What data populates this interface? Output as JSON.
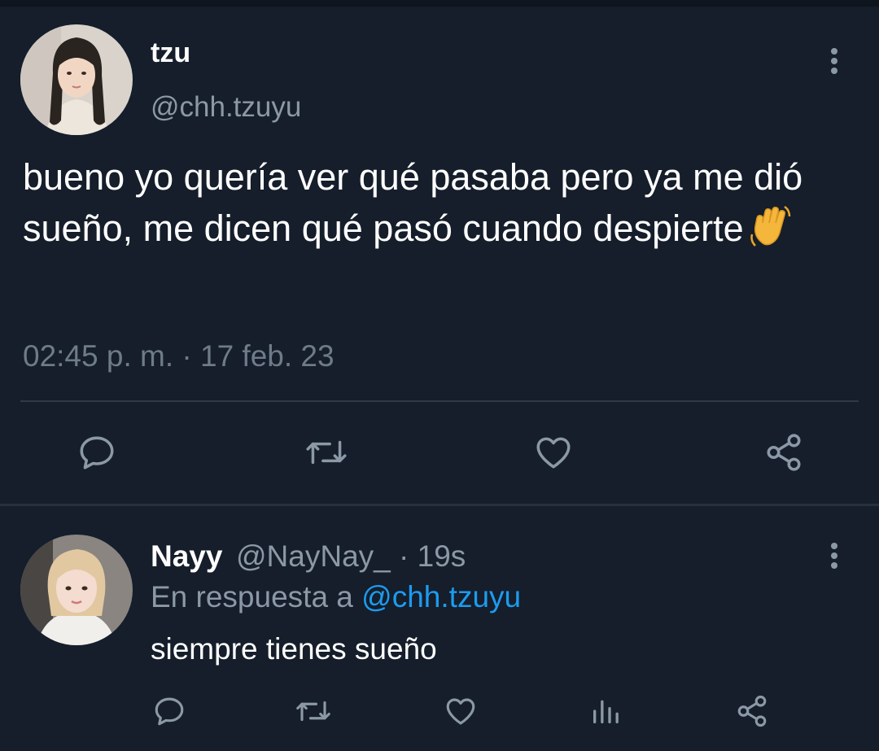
{
  "tweet": {
    "display_name": "tzu",
    "handle": "@chh.tzuyu",
    "text": "bueno yo quería ver qué pasaba pero ya me dió sueño, me dicen qué pasó cuando despierte",
    "emoji": "waving-hand",
    "timestamp": "02:45 p. m. · 17 feb. 23",
    "actions": [
      "reply-icon",
      "retweet-icon",
      "like-icon",
      "share-icon"
    ]
  },
  "reply": {
    "display_name": "Nayy",
    "meta": "@NayNay_ · 19s",
    "reply_prefix": "En respuesta a",
    "reply_mention": "@chh.tzuyu",
    "text": "siempre tienes sueño",
    "actions": [
      "reply-icon",
      "retweet-icon",
      "like-icon",
      "views-icon",
      "share-icon"
    ]
  },
  "colors": {
    "background": "#151e2a",
    "text": "#ffffff",
    "secondary_text": "#8b98a5",
    "mention": "#1d9bf0",
    "icon": "#8b98a5"
  }
}
